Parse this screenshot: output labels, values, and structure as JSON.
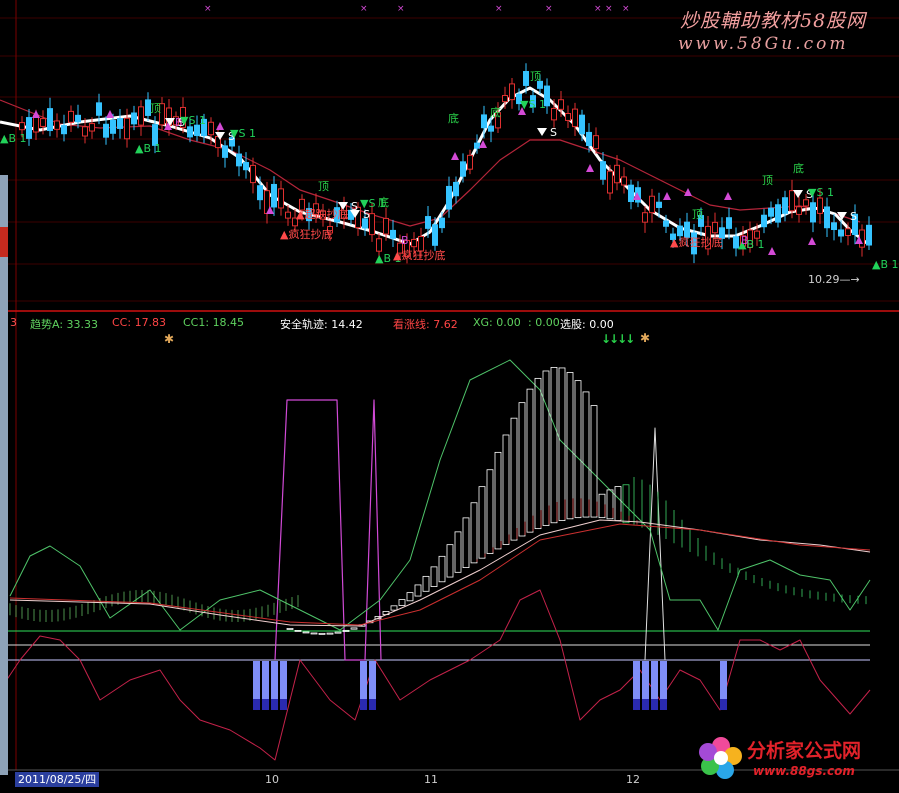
{
  "watermark_top": {
    "cn": "炒股輔助教材58股网",
    "url": "www.58Gu.com"
  },
  "watermark_bottom": {
    "cn": "分析家公式网",
    "url": "www.88gs.com"
  },
  "price_panel": {
    "signals": {
      "buy": "B",
      "buy1": "B 1",
      "sell": "S",
      "sell1": "S 1",
      "top": "顶",
      "bottom": "底"
    },
    "annotations": {
      "chase_bottom": "超跌抄底",
      "crazy_bottom": "疯狂抄底"
    },
    "end_price_label": "10.29"
  },
  "indicator_header": {
    "trend_a": "趋势A: 33.33",
    "cc": "CC: 17.83",
    "cc1": "CC1: 18.45",
    "safe_track": "安全轨迹: 14.42",
    "bull_strength": "看涨线: 7.62",
    "xg": "XG: 0.00",
    "xg2": ": 0.00",
    "pick": "选股: 0.00",
    "head_left": "3"
  },
  "markers": {
    "arrows": "↓↓↓↓"
  },
  "time_axis": {
    "date_label": "2011/08/25/四",
    "months": [
      "10",
      "11",
      "12"
    ]
  },
  "colors": {
    "bg": "#000000",
    "up_candle": "#e03030",
    "down_candle": "#35c3ff",
    "ma_white": "#ffffff",
    "ma_red": "#b5253a",
    "buy_green": "#22d25a",
    "buy_magenta": "#d44ad6",
    "sell_white": "#ffffff",
    "grid_red": "#7a0000",
    "divider": "#d01010",
    "magenta_line": "#d14ad6",
    "green_line": "#4fc46a",
    "crimson_line": "#c4224a",
    "blue_bar": "#7f8ef7",
    "blue_bar_dark": "#2a2ab0"
  }
}
